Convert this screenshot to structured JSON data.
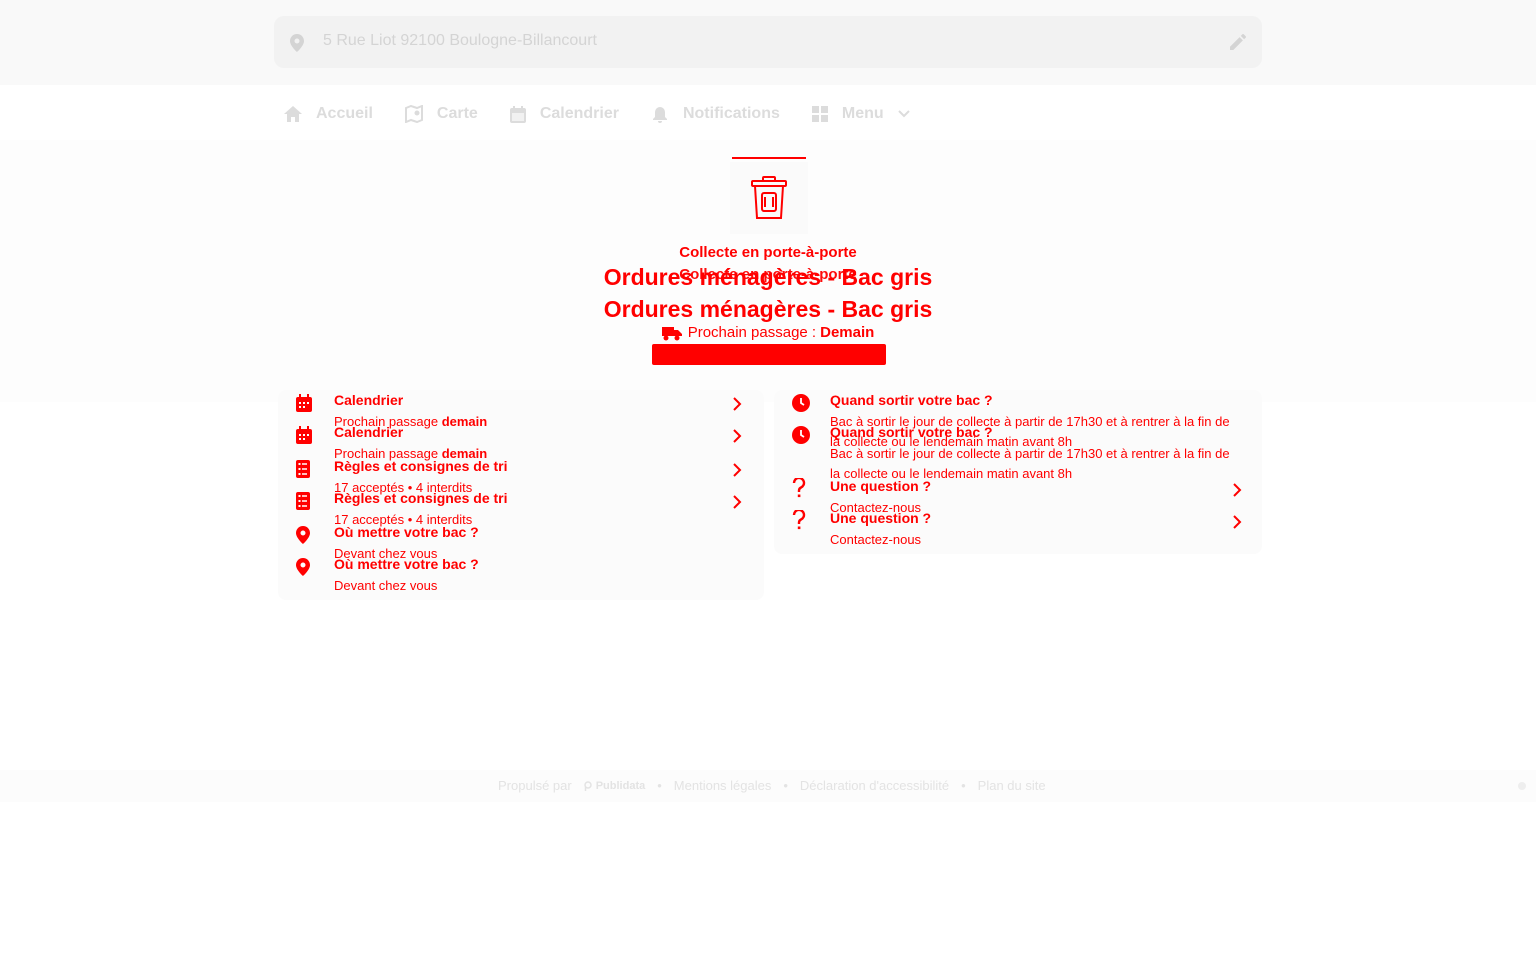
{
  "address": {
    "text": "5 Rue Liot 92100 Boulogne-Billancourt",
    "icon": "location-pin-icon",
    "edit_icon": "pencil-icon"
  },
  "nav": {
    "items": [
      {
        "label": "Accueil",
        "icon": "home-icon"
      },
      {
        "label": "Carte",
        "icon": "map-icon"
      },
      {
        "label": "Calendrier",
        "icon": "calendar-icon"
      },
      {
        "label": "Notifications",
        "icon": "bell-icon"
      },
      {
        "label": "Menu",
        "icon": "grid-icon"
      }
    ]
  },
  "hero": {
    "subtitle": "Collecte en porte-à-porte",
    "title": "Ordures ménagères - Bac gris",
    "next_label": "Prochain passage :",
    "next_value": "Demain"
  },
  "left_card": {
    "rows": [
      {
        "title": "Calendrier",
        "subtitle": "Prochain passage",
        "subtitle_bold": "demain"
      },
      {
        "title": "Calendrier",
        "subtitle": "Prochain passage",
        "subtitle_bold": "demain"
      },
      {
        "title": "Règles et consignes de tri",
        "subtitle": "17 acceptés • 4 interdits",
        "subtitle_bold": ""
      },
      {
        "title": "Règles et consignes de tri",
        "subtitle": "17 acceptés • 4 interdits",
        "subtitle_bold": ""
      },
      {
        "title": "Où mettre votre bac ?",
        "subtitle": "Devant chez vous",
        "subtitle_bold": ""
      },
      {
        "title": "Où mettre votre bac ?",
        "subtitle": "Devant chez vous",
        "subtitle_bold": ""
      }
    ]
  },
  "right_card": {
    "rows": [
      {
        "title": "Quand sortir votre bac ?",
        "line1": "Bac à sortir le jour de collecte à partir de 17h30 et à rentrer à la fin de",
        "line2": "la collecte ou le lendemain matin avant 8h"
      },
      {
        "title": "Quand sortir votre bac ?",
        "line1": "Bac à sortir le jour de collecte à partir de 17h30 et à rentrer à la fin de",
        "line2": "la collecte ou le lendemain matin avant 8h"
      },
      {
        "title": "Une question ?",
        "line1": "Contactez-nous",
        "line2": ""
      },
      {
        "title": "Une question ?",
        "line1": "Contactez-nous",
        "line2": ""
      }
    ]
  },
  "footer": {
    "powered": "Propulsé par",
    "brand": "Publidata",
    "links": [
      "Mentions légales",
      "Déclaration d'accessibilité",
      "Plan du site"
    ]
  },
  "colors": {
    "accent": "#ff0000",
    "muted": "#dcdcdc"
  }
}
